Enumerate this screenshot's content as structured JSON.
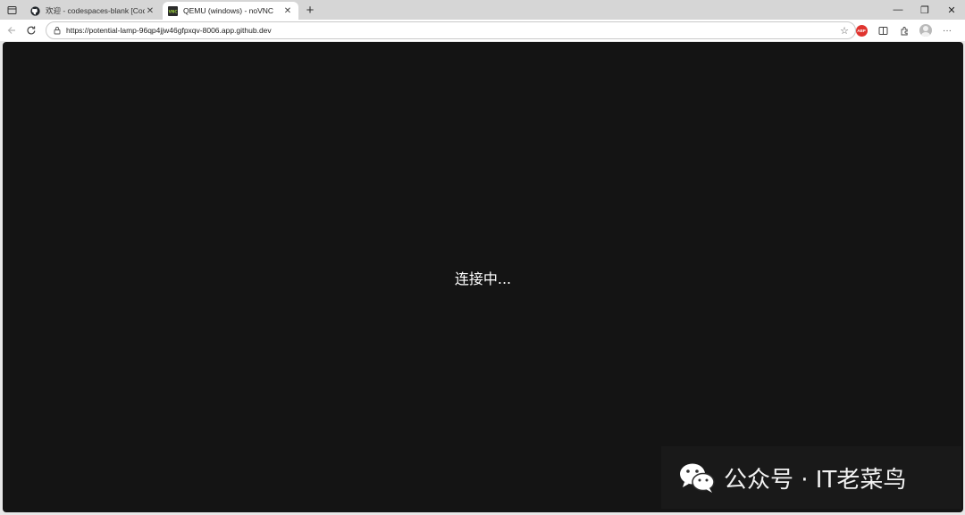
{
  "browser": {
    "tabs": [
      {
        "title": "欢迎 - codespaces-blank [Codesp",
        "favicon": "github-icon",
        "active": false
      },
      {
        "title": "QEMU (windows) - noVNC",
        "favicon": "novnc-icon",
        "active": true
      }
    ],
    "new_tab_label": "+",
    "window_controls": {
      "minimize": "—",
      "restore": "❐",
      "close": "✕"
    },
    "address_bar": {
      "url": "https://potential-lamp-96qp4jjw46gfpxqv-8006.app.github.dev"
    },
    "toolbar_icons": [
      "favorite-star-icon",
      "adblock-icon",
      "split-screen-icon",
      "extensions-icon",
      "profile-avatar-icon",
      "more-menu-icon"
    ],
    "adblock_label": "ABP",
    "more_label": "···"
  },
  "page": {
    "background_color": "#141414",
    "status_text": "连接中..."
  },
  "watermark": {
    "text": "公众号 · IT老菜鸟",
    "icon": "wechat-icon"
  }
}
